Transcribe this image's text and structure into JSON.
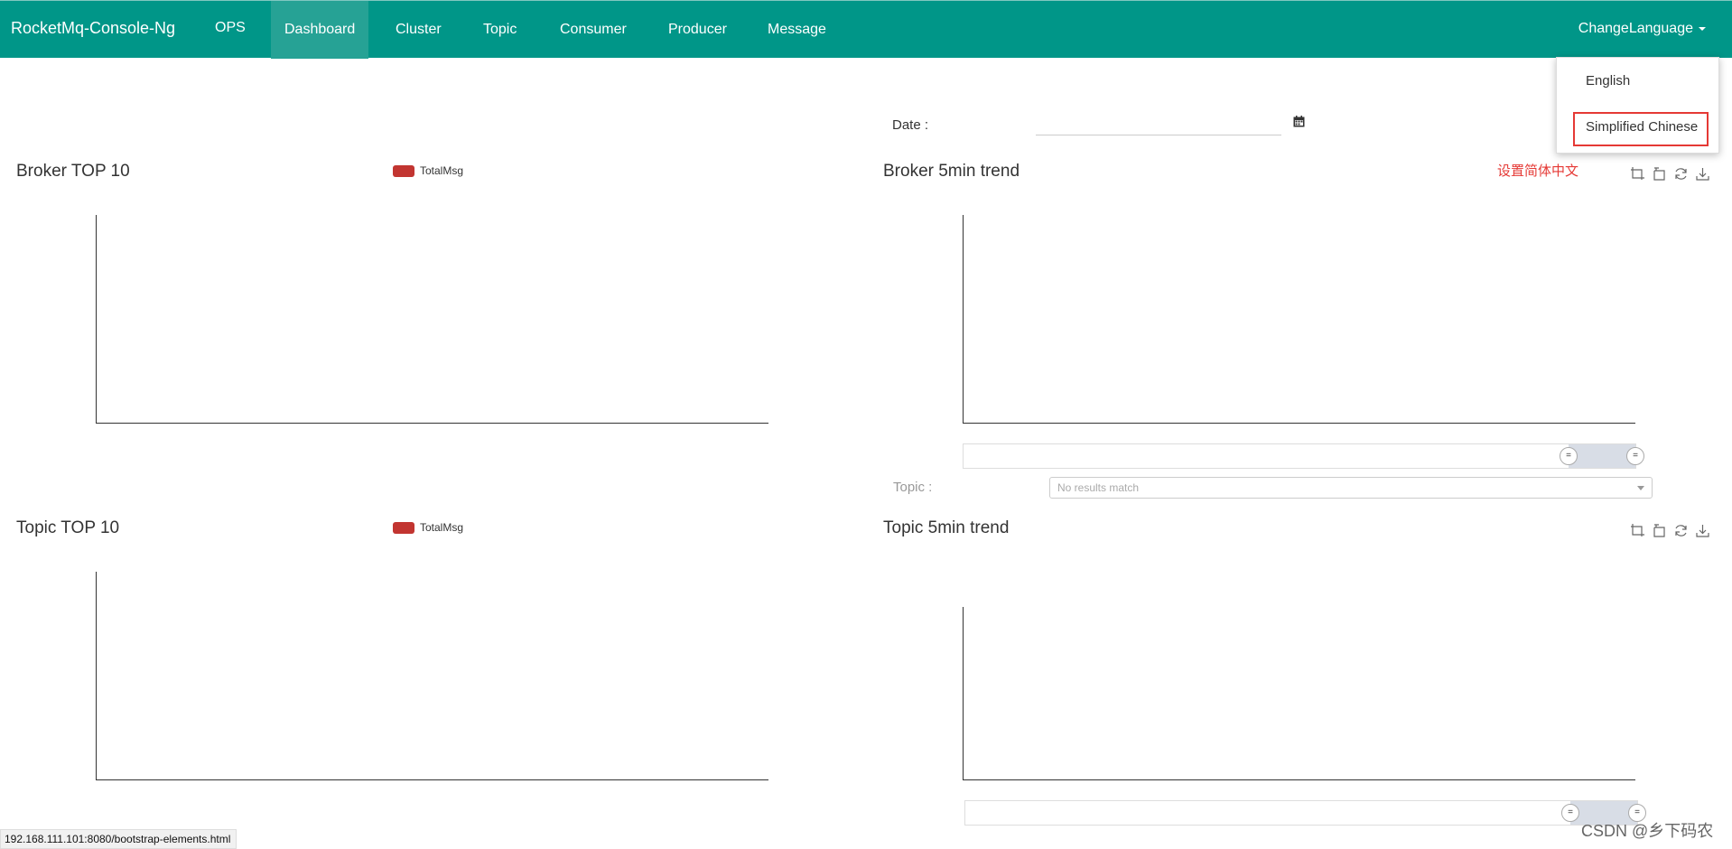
{
  "navbar": {
    "brand": "RocketMq-Console-Ng",
    "items": [
      {
        "label": "OPS"
      },
      {
        "label": "Dashboard"
      },
      {
        "label": "Cluster"
      },
      {
        "label": "Topic"
      },
      {
        "label": "Consumer"
      },
      {
        "label": "Producer"
      },
      {
        "label": "Message"
      }
    ],
    "active": "Dashboard",
    "language_toggle": "ChangeLanguage"
  },
  "language_menu": {
    "options": [
      "English",
      "Simplified Chinese"
    ],
    "highlighted": "Simplified Chinese"
  },
  "annotation": "设置简体中文",
  "filters": {
    "date_label": "Date :",
    "date_value": "",
    "topic_label": "Topic :",
    "topic_placeholder": "No results match"
  },
  "charts": {
    "broker_top": {
      "title": "Broker TOP 10",
      "legend": "TotalMsg"
    },
    "broker_trend": {
      "title": "Broker 5min trend"
    },
    "topic_top": {
      "title": "Topic TOP 10",
      "legend": "TotalMsg"
    },
    "topic_trend": {
      "title": "Topic 5min trend"
    }
  },
  "status_bar": {
    "url": "192.168.111.101:8080/bootstrap-elements.html"
  },
  "watermark": "CSDN @乡下码农",
  "colors": {
    "navbar": "#009688",
    "legend_series": "#c23531",
    "annotation": "#e53935"
  },
  "chart_data": [
    {
      "type": "bar",
      "title": "Broker TOP 10",
      "categories": [],
      "series": [
        {
          "name": "TotalMsg",
          "values": []
        }
      ]
    },
    {
      "type": "line",
      "title": "Broker 5min trend",
      "x": [],
      "series": []
    },
    {
      "type": "bar",
      "title": "Topic TOP 10",
      "categories": [],
      "series": [
        {
          "name": "TotalMsg",
          "values": []
        }
      ]
    },
    {
      "type": "line",
      "title": "Topic 5min trend",
      "x": [],
      "series": []
    }
  ]
}
